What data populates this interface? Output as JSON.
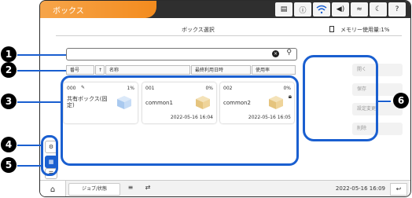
{
  "app": {
    "title": "ボックス"
  },
  "status_icons": [
    "document-icon",
    "info-icon",
    "wifi-direct-icon",
    "volume-icon",
    "wifi-off-icon",
    "moon-icon",
    "help-icon"
  ],
  "screen": {
    "title": "ボックス選択",
    "memory": "メモリー使用量:1%"
  },
  "columns": [
    "番号",
    "↑",
    "名称",
    "最終利用日時",
    "使用率"
  ],
  "boxes": [
    {
      "num": "000",
      "pct": "1%",
      "name": "共有ボックス(固定)",
      "date": "",
      "locked": false
    },
    {
      "num": "001",
      "pct": "0%",
      "name": "common1",
      "date": "2022-05-16 16:04",
      "locked": false
    },
    {
      "num": "002",
      "pct": "0%",
      "name": "common2",
      "date": "2022-05-16 16:05",
      "locked": true
    }
  ],
  "side_actions": [
    "開く",
    "保存",
    "設定変更",
    "削除"
  ],
  "bottom": {
    "job_status": "ジョブ/状態",
    "clock": "2022-05-16 16:09"
  },
  "callouts": [
    "1",
    "2",
    "3",
    "4",
    "5",
    "6"
  ],
  "colors": {
    "accent_blue": "#1a5fd0",
    "title_orange": "#f38b1e",
    "topbar": "#2f2f2f"
  }
}
